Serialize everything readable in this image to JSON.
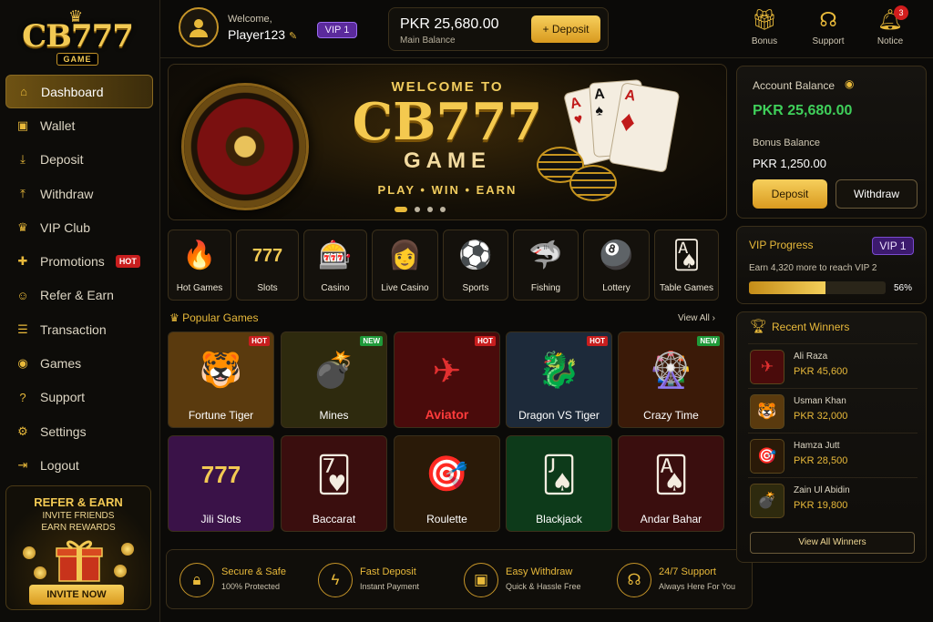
{
  "brand": {
    "logo": "CB777",
    "logo_sub": "GAME"
  },
  "sidebar": {
    "items": [
      {
        "label": "Dashboard",
        "icon": "home-icon"
      },
      {
        "label": "Wallet",
        "icon": "wallet-icon"
      },
      {
        "label": "Deposit",
        "icon": "download-icon"
      },
      {
        "label": "Withdraw",
        "icon": "upload-icon"
      },
      {
        "label": "VIP Club",
        "icon": "crown-icon"
      },
      {
        "label": "Promotions",
        "icon": "gift-icon",
        "badge": "HOT"
      },
      {
        "label": "Refer & Earn",
        "icon": "users-icon"
      },
      {
        "label": "Transaction",
        "icon": "list-icon"
      },
      {
        "label": "Games",
        "icon": "gamepad-icon"
      },
      {
        "label": "Support",
        "icon": "help-icon"
      },
      {
        "label": "Settings",
        "icon": "gear-icon"
      },
      {
        "label": "Logout",
        "icon": "logout-icon"
      }
    ],
    "refer": {
      "title": "REFER & EARN",
      "line1": "INVITE FRIENDS",
      "line2": "EARN REWARDS",
      "button": "INVITE NOW"
    }
  },
  "header": {
    "welcome": "Welcome,",
    "username": "Player123",
    "vip": "VIP 1",
    "balance": "PKR 25,680.00",
    "balance_label": "Main Balance",
    "deposit": "+ Deposit",
    "icons": [
      {
        "label": "Bonus"
      },
      {
        "label": "Support"
      },
      {
        "label": "Notice",
        "count": "3"
      }
    ]
  },
  "banner": {
    "welcome": "WELCOME TO",
    "title": "CB777",
    "game": "GAME",
    "tagline": "PLAY • WIN • EARN"
  },
  "categories": [
    {
      "label": "Hot Games",
      "art": "🔥"
    },
    {
      "label": "Slots",
      "art": "777"
    },
    {
      "label": "Casino",
      "art": "🎰"
    },
    {
      "label": "Live Casino",
      "art": "👩"
    },
    {
      "label": "Sports",
      "art": "⚽"
    },
    {
      "label": "Fishing",
      "art": "🦈"
    },
    {
      "label": "Lottery",
      "art": "🎱"
    },
    {
      "label": "Table Games",
      "art": "🂡"
    }
  ],
  "popular": {
    "title": "Popular Games",
    "view_all": "View All ›",
    "games": [
      {
        "label": "Fortune Tiger",
        "tag": "HOT",
        "art": "🐯",
        "bg": "#5a3a0e"
      },
      {
        "label": "Mines",
        "tag": "NEW",
        "art": "💣",
        "bg": "#2e2a0e"
      },
      {
        "label": "Aviator",
        "tag": "HOT",
        "art": "✈",
        "bg": "#4a0b0b"
      },
      {
        "label": "Dragon VS Tiger",
        "tag": "HOT",
        "art": "🐉",
        "bg": "#1d2a3a"
      },
      {
        "label": "Crazy Time",
        "tag": "NEW",
        "art": "🎡",
        "bg": "#3b1a08"
      },
      {
        "label": "Jili Slots",
        "tag": "",
        "art": "777",
        "bg": "#3a1248"
      },
      {
        "label": "Baccarat",
        "tag": "",
        "art": "🂷",
        "bg": "#3a0e0e"
      },
      {
        "label": "Roulette",
        "tag": "",
        "art": "🎯",
        "bg": "#2a1a08"
      },
      {
        "label": "Blackjack",
        "tag": "",
        "art": "🂫",
        "bg": "#0d3a1a"
      },
      {
        "label": "Andar Bahar",
        "tag": "",
        "art": "🂡",
        "bg": "#3a0e0e"
      }
    ]
  },
  "features": [
    {
      "title": "Secure & Safe",
      "sub": "100% Protected",
      "icon": "lock-icon"
    },
    {
      "title": "Fast Deposit",
      "sub": "Instant Payment",
      "icon": "bolt-icon"
    },
    {
      "title": "Easy Withdraw",
      "sub": "Quick & Hassle Free",
      "icon": "wallet-icon"
    },
    {
      "title": "24/7 Support",
      "sub": "Always Here For You",
      "icon": "headset-icon"
    }
  ],
  "account": {
    "label": "Account Balance",
    "balance": "PKR 25,680.00",
    "bonus_label": "Bonus Balance",
    "bonus": "PKR 1,250.00",
    "deposit": "Deposit",
    "withdraw": "Withdraw"
  },
  "vip": {
    "title": "VIP Progress",
    "level": "VIP 1",
    "sub": "Earn 4,320 more to reach VIP 2",
    "progress": 0.56,
    "pct": "56%"
  },
  "winners": {
    "title": "Recent Winners",
    "view_all": "View All Winners",
    "list": [
      {
        "name": "Ali Raza",
        "amount": "PKR 45,600",
        "art": "✈"
      },
      {
        "name": "Usman Khan",
        "amount": "PKR 32,000",
        "art": "🐯"
      },
      {
        "name": "Hamza Jutt",
        "amount": "PKR 28,500",
        "art": "🎯"
      },
      {
        "name": "Zain Ul Abidin",
        "amount": "PKR 19,800",
        "art": "💣"
      }
    ]
  }
}
